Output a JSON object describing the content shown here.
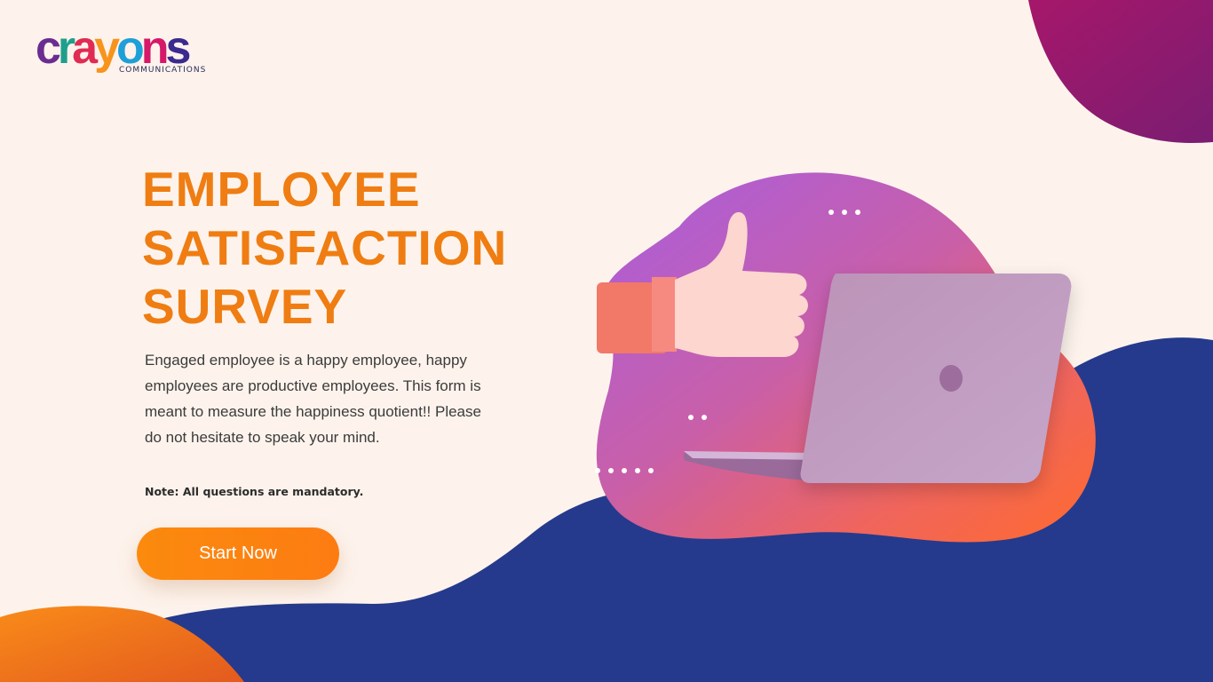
{
  "brand": {
    "logo_letters": [
      "c",
      "r",
      "a",
      "y",
      "o",
      "n",
      "s"
    ],
    "logo_colors": [
      "#6a2c91",
      "#1e9f8c",
      "#e02b52",
      "#f7941d",
      "#1e9fd8",
      "#d6186a",
      "#3b2a8f"
    ],
    "logo_subtitle": "COMMUNICATIONS"
  },
  "hero": {
    "title_lines": [
      "EMPLOYEE",
      "SATISFACTION",
      "SURVEY"
    ],
    "description": "Engaged employee is a happy employee, happy employees are productive employees. This form is meant to measure the happiness quotient!! Please do not hesitate to speak your mind.",
    "note": "Note: All questions are mandatory.",
    "start_button_label": "Start Now"
  },
  "colors": {
    "background": "#fdf3ec",
    "title": "#ef7d12",
    "navy_wave": "#253a8c",
    "button": "#fb8a0e",
    "blob_purple": "#b05dd6",
    "blob_orange": "#ff6a2e",
    "corner_magenta": "#9b1b6c"
  },
  "illustration": {
    "icons": [
      "thumbs-up-icon",
      "laptop-icon",
      "chat-dots-icon"
    ]
  }
}
